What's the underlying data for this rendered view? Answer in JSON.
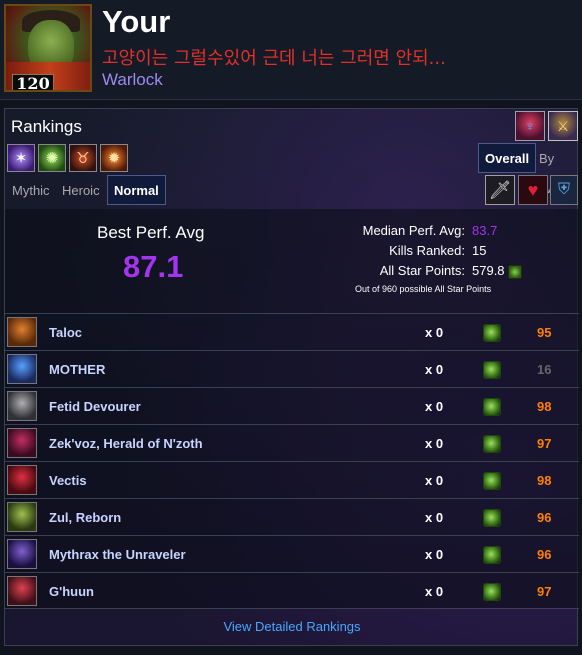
{
  "character": {
    "name": "Your",
    "title": "고양이는 그럴수있어 근데 너는 그러면 안되...",
    "class": "Warlock",
    "level": "120",
    "colors": {
      "title": "#e0302a",
      "class": "#9a8cf0"
    }
  },
  "rankings": {
    "heading": "Rankings",
    "header_icons": [
      "boss-portrait-icon",
      "boss-portrait-icon"
    ],
    "spec_icons": [
      "affliction-icon",
      "demonology-icon",
      "demon-portrait-icon",
      "destruction-icon"
    ],
    "metric_tabs": [
      {
        "label": "Overall",
        "active": true
      },
      {
        "label": "By Ilvl",
        "active": false
      }
    ],
    "difficulty_tabs": [
      {
        "label": "Mythic",
        "active": false
      },
      {
        "label": "Heroic",
        "active": false
      },
      {
        "label": "Normal",
        "active": true
      }
    ],
    "filter_icons": [
      "dps-icon",
      "healer-icon",
      "tank-icon"
    ],
    "summary": {
      "best_perf_label": "Best Perf. Avg",
      "best_perf_value": "87.1",
      "median_label": "Median Perf. Avg:",
      "median_value": "83.7",
      "kills_label": "Kills Ranked:",
      "kills_value": "15",
      "star_label": "All Star Points:",
      "star_value": "579.8",
      "star_note": "Out of 960 possible All Star Points"
    },
    "bosses": [
      {
        "name": "Taloc",
        "kills": "x 0",
        "score": "95",
        "color": "#ff8000"
      },
      {
        "name": "MOTHER",
        "kills": "x 0",
        "score": "16",
        "color": "#666666"
      },
      {
        "name": "Fetid Devourer",
        "kills": "x 0",
        "score": "98",
        "color": "#ff8000"
      },
      {
        "name": "Zek'voz, Herald of N'zoth",
        "kills": "x 0",
        "score": "97",
        "color": "#ff8000"
      },
      {
        "name": "Vectis",
        "kills": "x 0",
        "score": "98",
        "color": "#ff8000"
      },
      {
        "name": "Zul, Reborn",
        "kills": "x 0",
        "score": "96",
        "color": "#ff8000"
      },
      {
        "name": "Mythrax the Unraveler",
        "kills": "x 0",
        "score": "96",
        "color": "#ff8000"
      },
      {
        "name": "G'huun",
        "kills": "x 0",
        "score": "97",
        "color": "#ff8000"
      }
    ],
    "footer_link": "View Detailed Rankings"
  }
}
